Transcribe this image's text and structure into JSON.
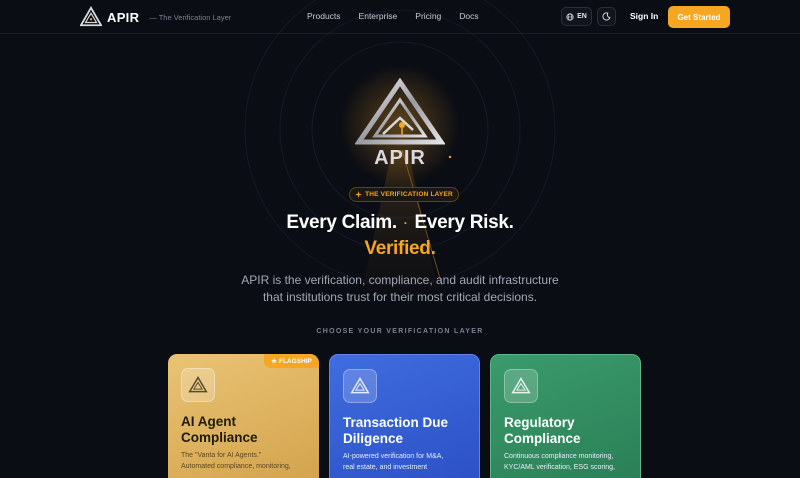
{
  "nav": {
    "brand": "APIR",
    "tagline": "— The Verification Layer",
    "links": [
      "Products",
      "Enterprise",
      "Pricing",
      "Docs"
    ],
    "lang": "EN",
    "sign_in": "Sign In",
    "cta": "Get Started"
  },
  "hero": {
    "logo_text": "APIR",
    "pill": "THE VERIFICATION LAYER",
    "headline_part1": "Every Claim.",
    "headline_dot": "·",
    "headline_part2": "Every Risk.",
    "headline_accent": "Verified.",
    "subline_1": "APIR is the verification, compliance, and audit infrastructure",
    "subline_2": "that institutions trust for their most critical decisions."
  },
  "section_label": "CHOOSE YOUR VERIFICATION LAYER",
  "cards": [
    {
      "badge": "FLAGSHIP",
      "title_1": "AI Agent",
      "title_2": "Compliance",
      "desc_1": "The \"Vanta for AI Agents.\"",
      "desc_2": "Automated compliance, monitoring,"
    },
    {
      "title_1": "Transaction Due",
      "title_2": "Diligence",
      "desc_1": "AI-powered verification for M&A,",
      "desc_2": "real estate, and investment"
    },
    {
      "title_1": "Regulatory",
      "title_2": "Compliance",
      "desc_1": "Continuous compliance monitoring,",
      "desc_2": "KYC/AML verification, ESG scoring,"
    }
  ],
  "colors": {
    "background": "#0b0d14",
    "accent": "#f5a623",
    "card_amber": "#dfb460",
    "card_blue": "#3560d6",
    "card_green": "#318c60"
  },
  "icons": [
    "apir-logo-icon",
    "globe-icon",
    "moon-icon",
    "sparkle-icon",
    "star-icon"
  ]
}
